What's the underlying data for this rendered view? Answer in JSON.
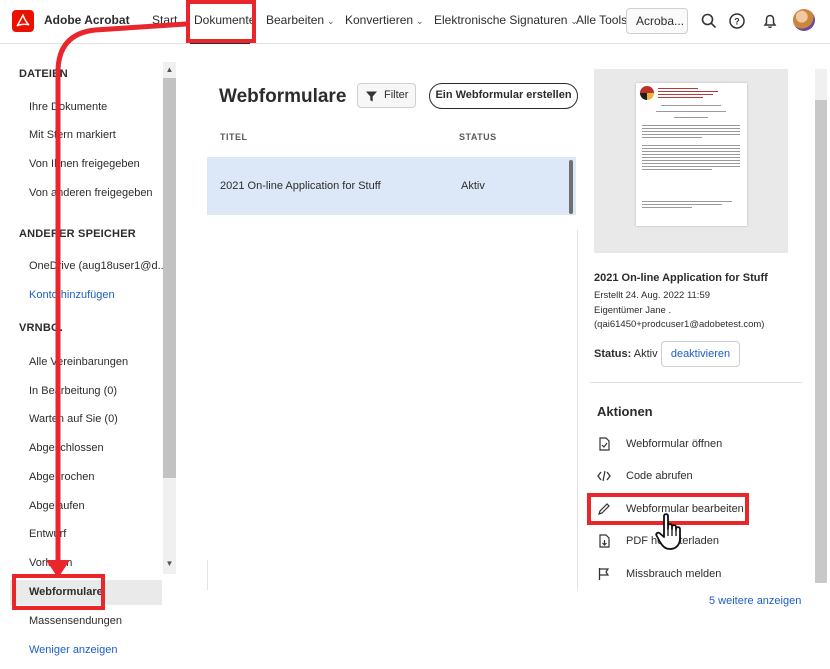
{
  "topbar": {
    "app_name": "Adobe Acrobat",
    "nav": {
      "start": "Start",
      "dokumente": "Dokumente",
      "bearbeiten": "Bearbeiten",
      "konvertieren": "Konvertieren",
      "elektronische_signaturen": "Elektronische Signaturen",
      "alle_tools": "Alle Tools"
    },
    "search_text": "Acroba...",
    "icons": [
      "search-icon",
      "help-icon",
      "bell-icon",
      "avatar"
    ]
  },
  "sidebar": {
    "dateien_head": "DATEIEN",
    "dateien": [
      "Ihre Dokumente",
      "Mit Stern markiert",
      "Von Ihnen freigegeben",
      "Von anderen freigegeben"
    ],
    "speicher_head": "ANDERER SPEICHER",
    "onedrive": "OneDrive (aug18user1@d...",
    "konto_hinzufuegen": "Konto hinzufügen",
    "vrnbg_head": "VRNBG.",
    "vrnbg": [
      "Alle Vereinbarungen",
      "In Bearbeitung (0)",
      "Warten auf Sie (0)",
      "Abgeschlossen",
      "Abgebrochen",
      "Abgelaufen",
      "Entwurf",
      "Vorlagen",
      "Webformulare",
      "Massensendungen"
    ],
    "weniger_anzeigen": "Weniger anzeigen"
  },
  "main": {
    "title": "Webformulare",
    "filter_label": "Filter",
    "create_label": "Ein Webformular erstellen",
    "col_title": "TITEL",
    "col_status": "STATUS",
    "rows": [
      {
        "name": "2021 On-line Application for Stuff",
        "status": "Aktiv"
      }
    ]
  },
  "detail": {
    "name": "2021 On-line Application for Stuff",
    "created": "Erstellt 24. Aug. 2022 11:59",
    "owner": "Eigentümer Jane .",
    "email": "(qai61450+prodcuser1@adobetest.com)",
    "status_label": "Status:",
    "status_value": "Aktiv",
    "deactivate": "deaktivieren",
    "actions_head": "Aktionen",
    "actions": [
      {
        "label": "Webformular öffnen",
        "icon": "document-open-icon"
      },
      {
        "label": "Code abrufen",
        "icon": "code-icon"
      },
      {
        "label": "Webformular bearbeiten",
        "icon": "pencil-icon"
      },
      {
        "label": "PDF herunterladen",
        "icon": "pdf-download-icon"
      },
      {
        "label": "Missbrauch melden",
        "icon": "flag-icon"
      }
    ],
    "more_link": "5 weitere anzeigen"
  },
  "preview_doc": {
    "header_lines": [
      "COLLEGE OF",
      "AGRICULTURE & NATURAL RESOURCES",
      "DEPARTMENT OF AGRICULTURAL &",
      "RESOURCE ECONOMICS"
    ]
  },
  "colors": {
    "accent_red": "#e8262b",
    "link_blue": "#1b5fc6",
    "selected_row": "#dce8f8",
    "acrobat_red": "#eb1000"
  }
}
